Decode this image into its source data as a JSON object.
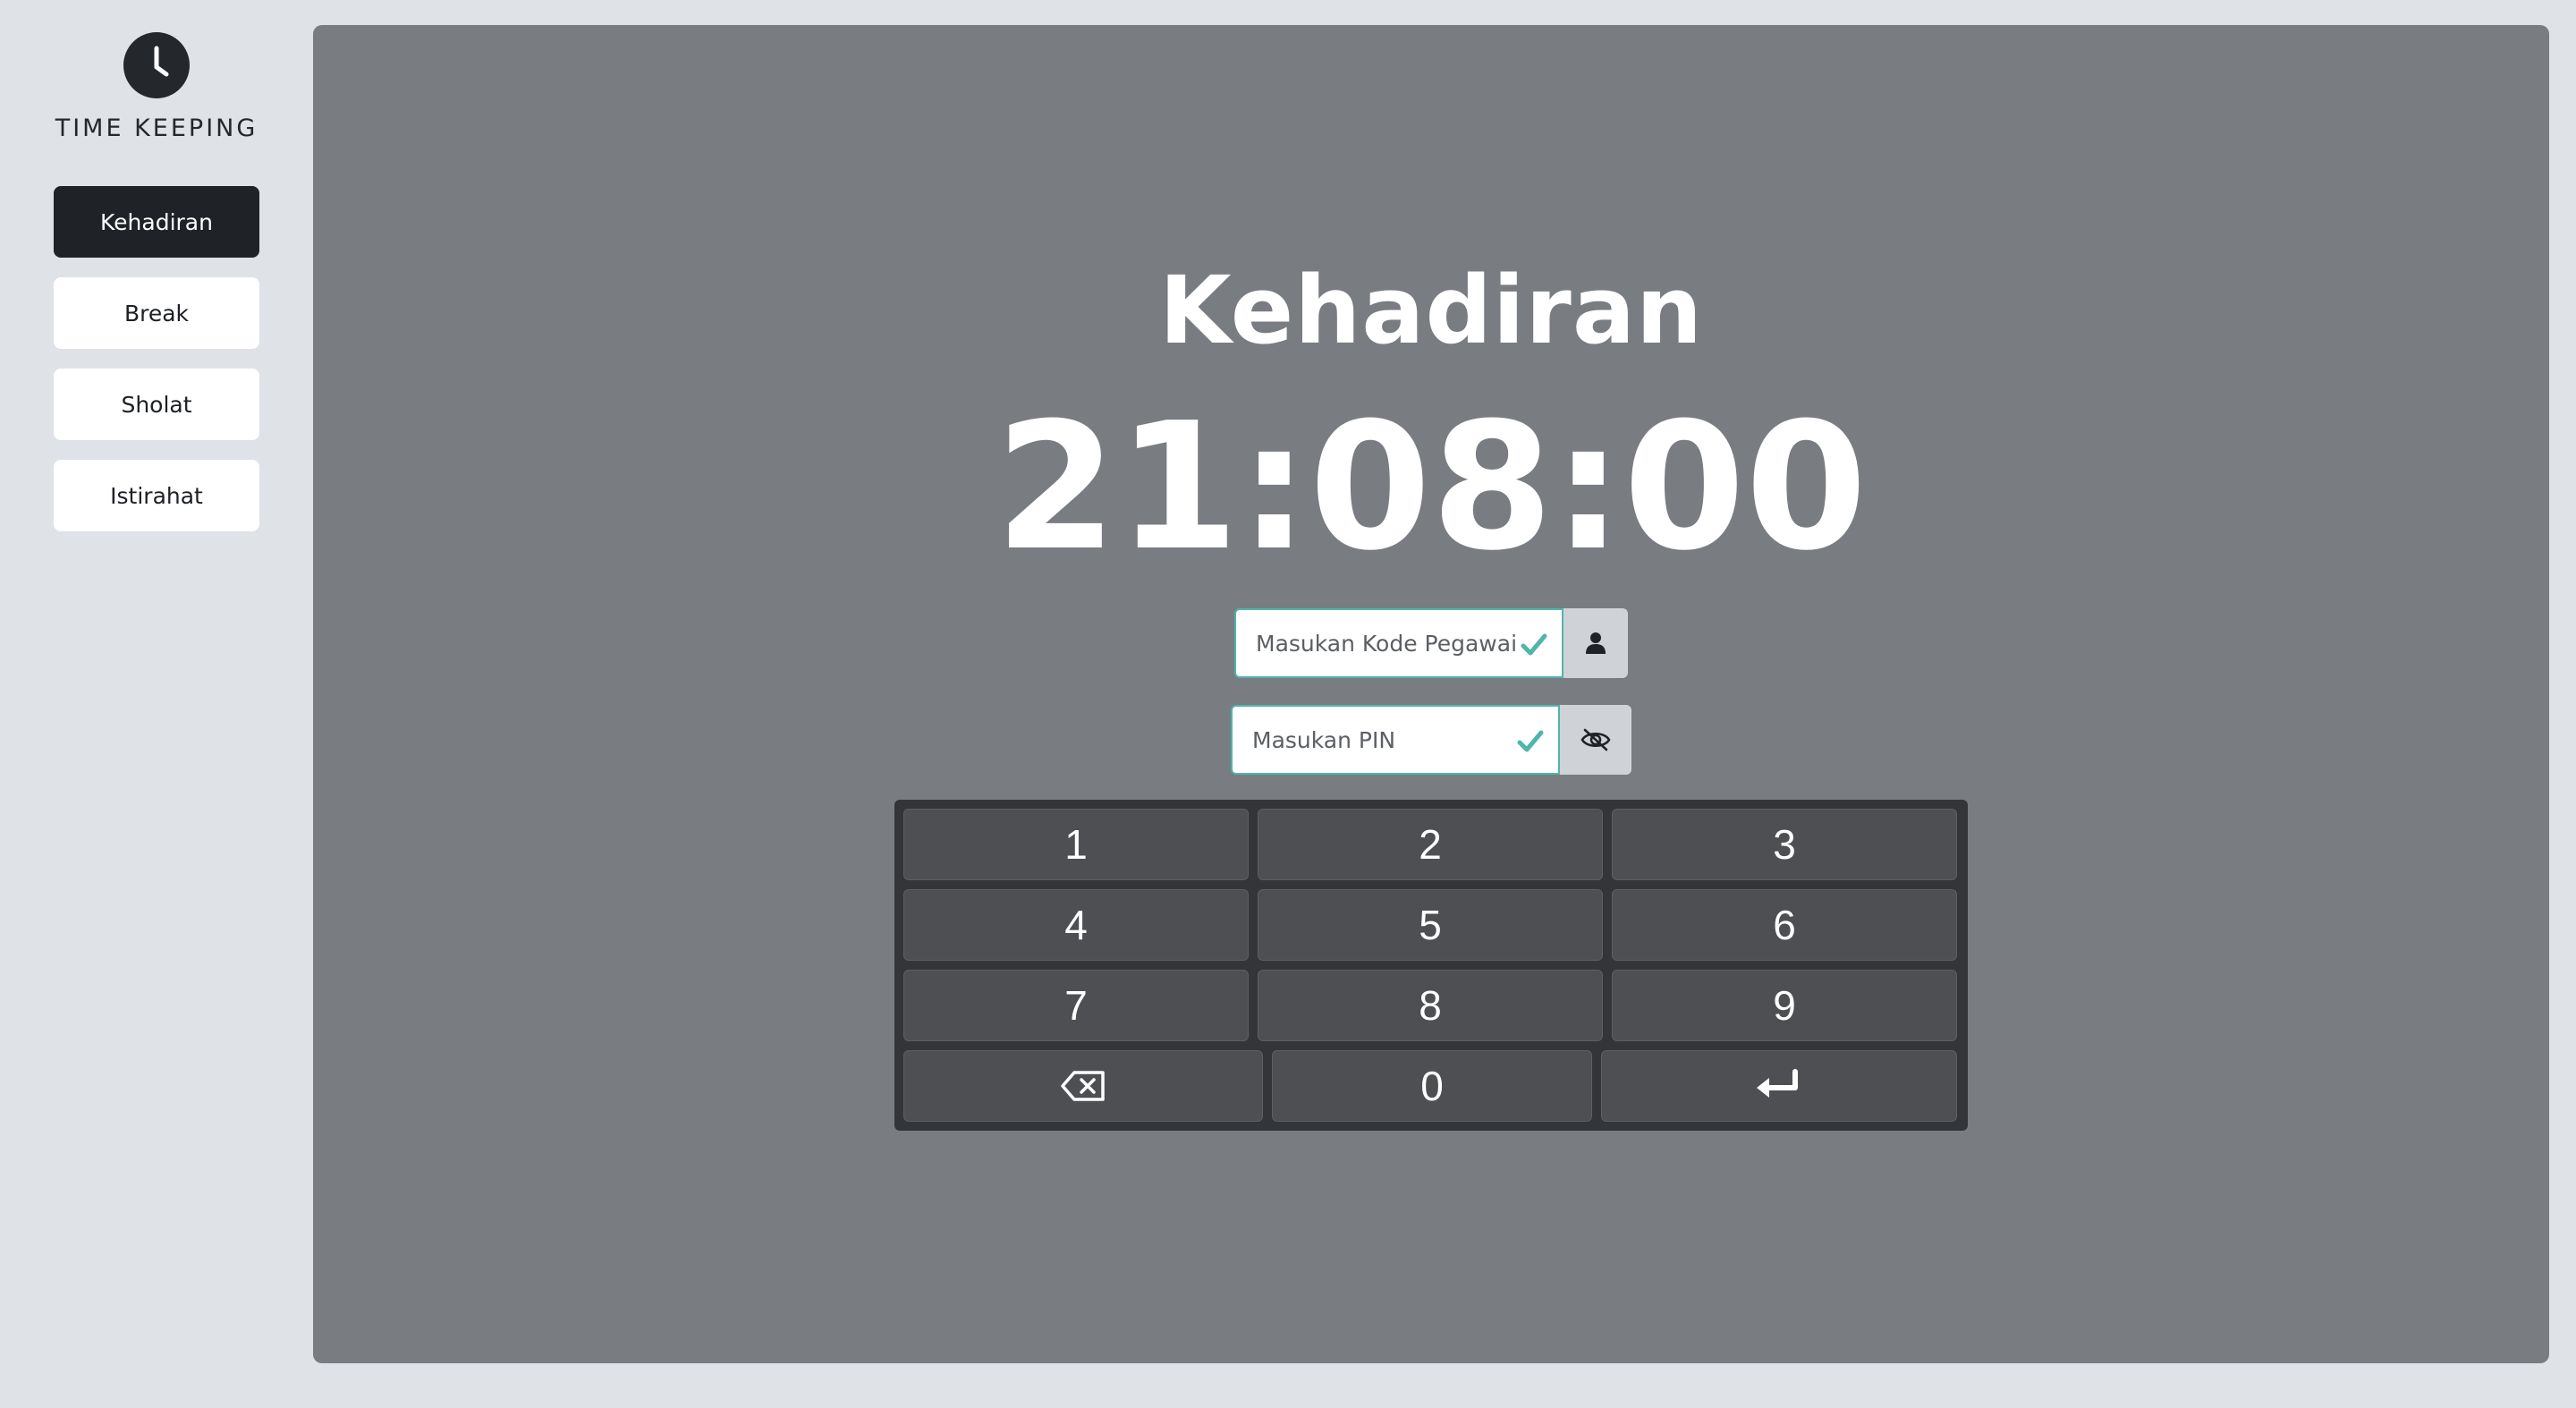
{
  "app": {
    "title": "TIME KEEPING",
    "logo_icon": "clock-icon"
  },
  "sidebar": {
    "items": [
      {
        "label": "Kehadiran",
        "active": true
      },
      {
        "label": "Break",
        "active": false
      },
      {
        "label": "Sholat",
        "active": false
      },
      {
        "label": "Istirahat",
        "active": false
      }
    ]
  },
  "main": {
    "title": "Kehadiran",
    "clock": "21:08:00",
    "employee_code": {
      "placeholder": "Masukan Kode Pegawai",
      "valid": true,
      "addon_icon": "user-icon"
    },
    "pin": {
      "placeholder": "Masukan PIN",
      "valid": true,
      "addon_icon": "eye-slash-icon"
    }
  },
  "keypad": {
    "keys": [
      "1",
      "2",
      "3",
      "4",
      "5",
      "6",
      "7",
      "8",
      "9",
      "0"
    ],
    "backspace_icon": "backspace-icon",
    "enter_icon": "enter-icon"
  },
  "colors": {
    "page_bg": "#dfe2e6",
    "panel_bg": "#797c81",
    "active_nav": "#1f2226",
    "valid_accent": "#4fb5ad",
    "keypad_bg": "#333538",
    "key_bg": "#4d4f52"
  }
}
